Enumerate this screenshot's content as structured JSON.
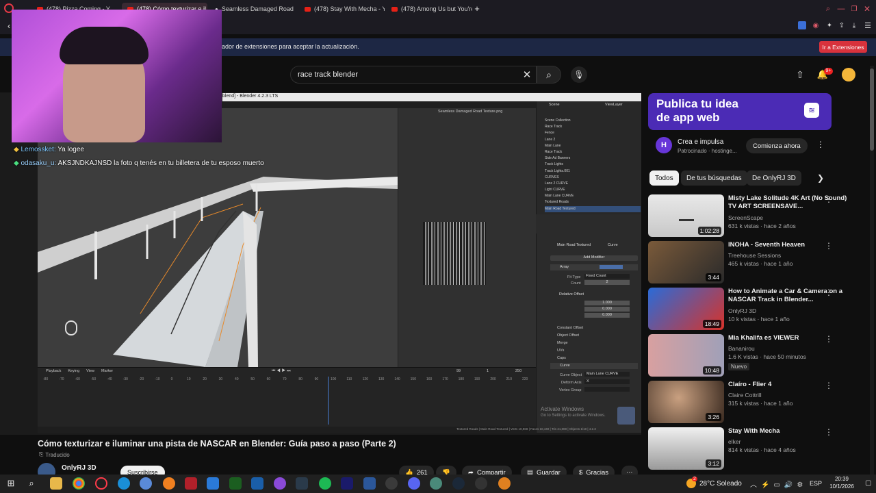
{
  "browser": {
    "tabs": [
      {
        "label": "(478) Pizza Coming - Y"
      },
      {
        "label": "(478) Cómo texturizar e il"
      },
      {
        "label": "Seamless Damaged Road"
      },
      {
        "label": "(478) Stay With Mecha - Y"
      },
      {
        "label": "(478) Among Us but You're"
      }
    ],
    "new_tab": "+",
    "extension_notice": "ador de extensiones para aceptar la actualización.",
    "extension_button": "Ir a Extensiones"
  },
  "youtube": {
    "search_query": "race track blender",
    "notif_count": "9+",
    "video_title": "Cómo texturizar e iluminar una pista de NASCAR en Blender: Guía paso a paso (Parte 2)",
    "translated_badge": "Traducido",
    "channel": "OnlyRJ 3D",
    "subscribe": "Suscribirse",
    "likes": "261",
    "share": "Compartir",
    "save": "Guardar",
    "thanks": "Gracias",
    "ad": {
      "banner_line1": "Publica tu idea",
      "banner_line2": "de app web",
      "title": "Crea e impulsa",
      "sponsor": "Patrocinado · hostinge...",
      "cta": "Comienza ahora"
    },
    "chips": [
      "Todos",
      "De tus búsquedas",
      "De OnlyRJ 3D"
    ],
    "recommendations": [
      {
        "title": "Misty Lake Solitude 4K Art (No Sound) TV ART SCREENSAVE...",
        "channel": "ScreenScape",
        "meta": "631 k vistas · hace 2 años",
        "duration": "1:02:28"
      },
      {
        "title": "INOHA - Seventh Heaven",
        "channel": "Treehouse Sessions",
        "meta": "465 k vistas · hace 1 año",
        "duration": "3:44"
      },
      {
        "title": "How to Animate a Car & Camera on a NASCAR Track in Blender...",
        "channel": "OnlyRJ 3D",
        "meta": "10 k vistas · hace 1 año",
        "duration": "18:49"
      },
      {
        "title": "Mia Khalifa es VIEWER",
        "channel": "Bananirou",
        "meta": "1.6 K vistas · hace 50 minutos",
        "badge": "Nuevo",
        "duration": "10:48"
      },
      {
        "title": "Claíro - Flier 4",
        "channel": "Claire Cottrill",
        "meta": "315 k vistas · hace 1 año",
        "duration": "3:26"
      },
      {
        "title": "Stay With Mecha",
        "channel": "elker",
        "meta": "814 k vistas · hace 4 años",
        "duration": "3:12"
      }
    ]
  },
  "stream": {
    "chat": [
      {
        "user": "Lemossket:",
        "text": "Ya logee"
      },
      {
        "user": "odasaku_u:",
        "text": "AKSJNDKAJNSD la foto q tenés en tu billetera de tu esposo muerto"
      }
    ]
  },
  "blender": {
    "window_title": "blend] - Blender 4.2.3 LTS",
    "uv_image": "Seamless Damaged Road Texture.png",
    "scene": "Scene",
    "view_layer": "ViewLayer",
    "outliner": [
      "Scene Collection",
      "Race Track",
      "Fence",
      "Lane 2",
      "Main Lane",
      "Race Track",
      "Side Ad Banners",
      "Track Lights",
      "Track Lights.001",
      "CURVES",
      "Lane 2 CURVE",
      "Light CURVE",
      "Main Lane CURVE",
      "Textured Roads",
      "Main Road Textured"
    ],
    "modifier_object": "Main Road Textured",
    "modifier_data": "Curve",
    "add_modifier": "Add Modifier",
    "array": "Array",
    "fit_type_label": "Fit Type",
    "fit_type": "Fixed Count",
    "count_label": "Count",
    "count": "2",
    "relative_offset": "Relative Offset",
    "factor_x": "1.000",
    "factor_y": "0.000",
    "factor_z": "0.000",
    "sections": [
      "Constant Offset",
      "Object Offset",
      "Merge",
      "UVs",
      "Caps"
    ],
    "curve_mod": "Curve",
    "curve_object_label": "Curve Object",
    "curve_object": "Main Lane CURVE",
    "deform_axis_label": "Deform Axis",
    "deform_axis": "X",
    "vertex_group_label": "Vertex Group",
    "timeline_menu": [
      "Playback",
      "Keying",
      "View",
      "Marker"
    ],
    "start": "1",
    "end": "250",
    "frame": "99",
    "timeline_ticks": [
      "-80",
      "-70",
      "-60",
      "-50",
      "-40",
      "-30",
      "-20",
      "-10",
      "0",
      "10",
      "20",
      "30",
      "40",
      "50",
      "60",
      "70",
      "80",
      "90",
      "100",
      "110",
      "120",
      "130",
      "140",
      "150",
      "160",
      "170",
      "180",
      "190",
      "200",
      "210",
      "220"
    ],
    "activate_line1": "Activate Windows",
    "activate_line2": "Go to Settings to activate Windows.",
    "status": "Textured Roads | Main Road Textured | Verts 10,968 | Faces 10,440 | Tris 21,080 | Objects 1/10 | 4.2.3"
  },
  "taskbar": {
    "weather": "28°C  Soleado",
    "lang": "ESP",
    "time": "20:39",
    "date": "10/1/2026",
    "weather_badge": "2"
  },
  "colors": {
    "accent": "#ff0000",
    "ad_bg": "#4b2bb5",
    "blender_orange": "#e88a2a"
  }
}
